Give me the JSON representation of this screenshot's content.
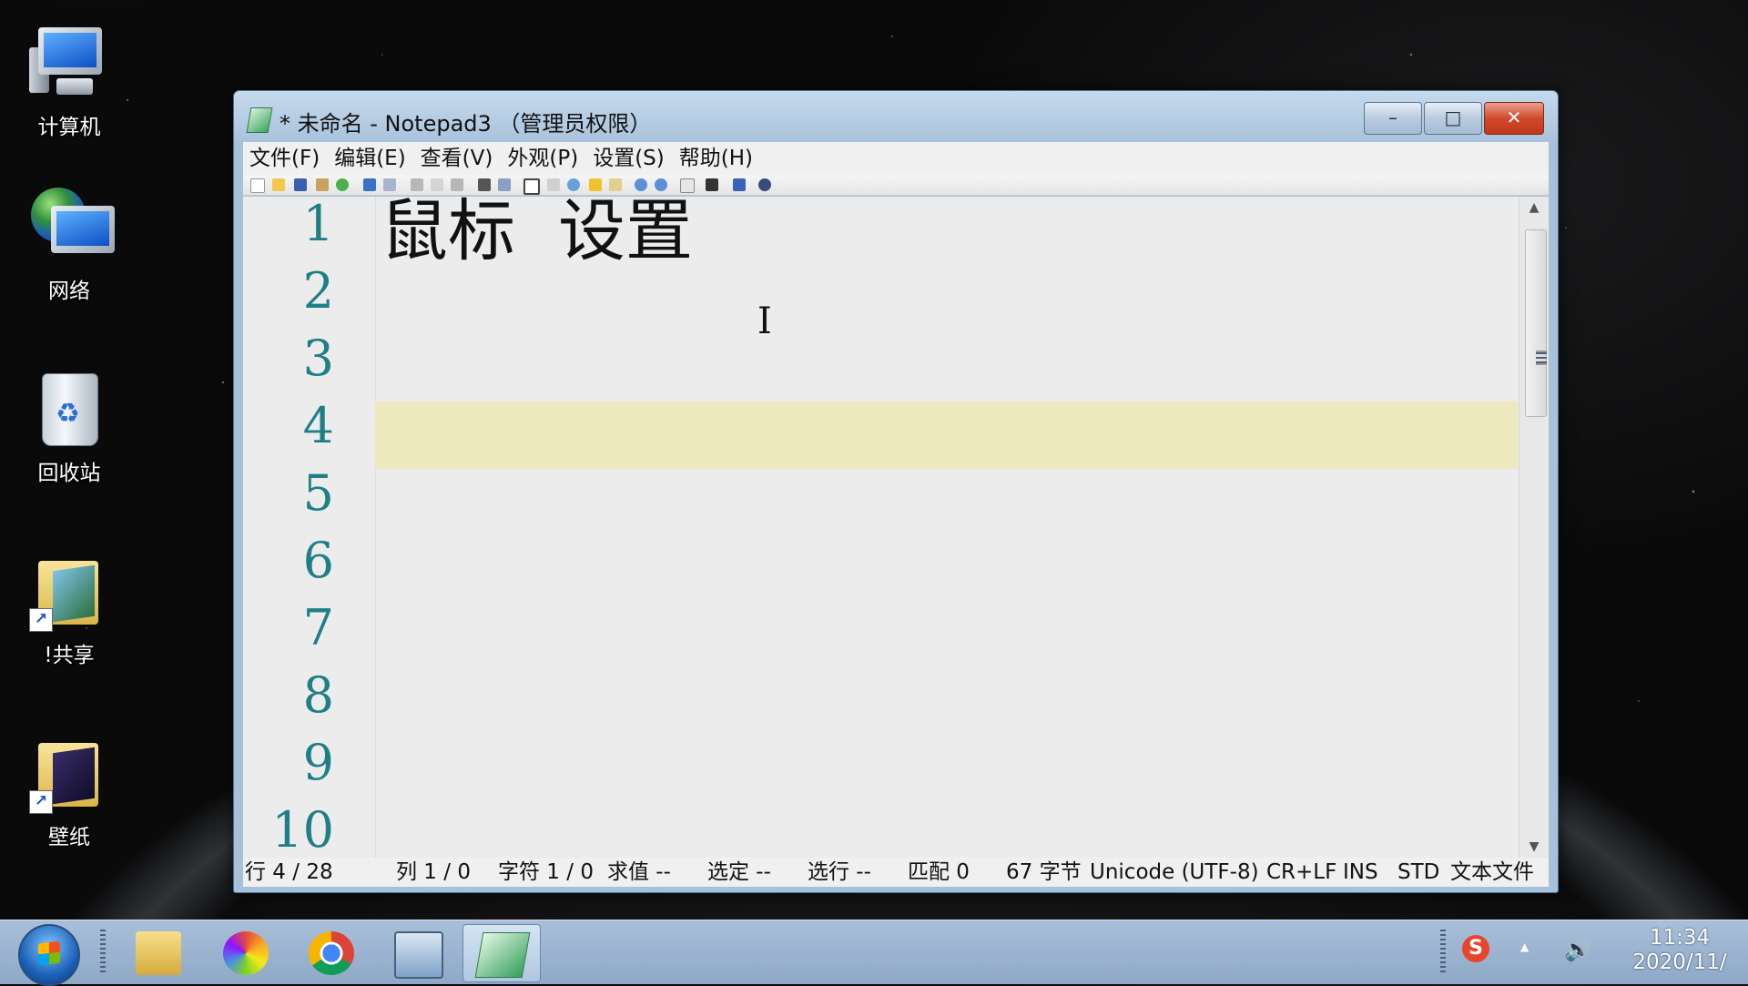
{
  "desktop": {
    "icons": [
      {
        "label": "计算机"
      },
      {
        "label": "网络"
      },
      {
        "label": "回收站"
      },
      {
        "label": "!共享"
      },
      {
        "label": "壁纸"
      }
    ]
  },
  "window": {
    "title": "* 未命名 - Notepad3 （管理员权限）",
    "buttons": {
      "minimize": "–",
      "maximize": "□",
      "close": "✕"
    },
    "menu": [
      "文件(F)",
      "编辑(E)",
      "查看(V)",
      "外观(P)",
      "设置(S)",
      "帮助(H)"
    ],
    "editor": {
      "lines": [
        "鼠标  设置",
        "",
        "",
        "",
        "",
        "",
        "",
        "",
        "",
        ""
      ],
      "line_numbers": [
        "1",
        "2",
        "3",
        "4",
        "5",
        "6",
        "7",
        "8",
        "9",
        "10"
      ],
      "current_line": 4
    },
    "status": {
      "line": "行  4 / 28",
      "column": "列  1 / 0",
      "char": "字符  1 / 0",
      "eval": "求值  --",
      "selected": "选定  --",
      "sel_lines": "选行  --",
      "match": "匹配  0",
      "bytes": "67 字节",
      "encoding": "Unicode (UTF-8)",
      "eol": "CR+LF",
      "ins": "INS",
      "std": "STD",
      "filetype": "文本文件"
    }
  },
  "taskbar": {
    "apps": [
      "file-explorer-icon",
      "photos-pinwheel-icon",
      "chrome-icon",
      "remote-desktop-icon",
      "notepad3-icon"
    ],
    "tray": {
      "ime": "S",
      "arrow": "▲",
      "volume": "🔊"
    },
    "clock": {
      "time": "11:34",
      "date": "2020/11/"
    }
  },
  "colors": {
    "current_line": "#ede8bd",
    "line_number": "#1f7f86",
    "close_button": "#d04a2c"
  }
}
